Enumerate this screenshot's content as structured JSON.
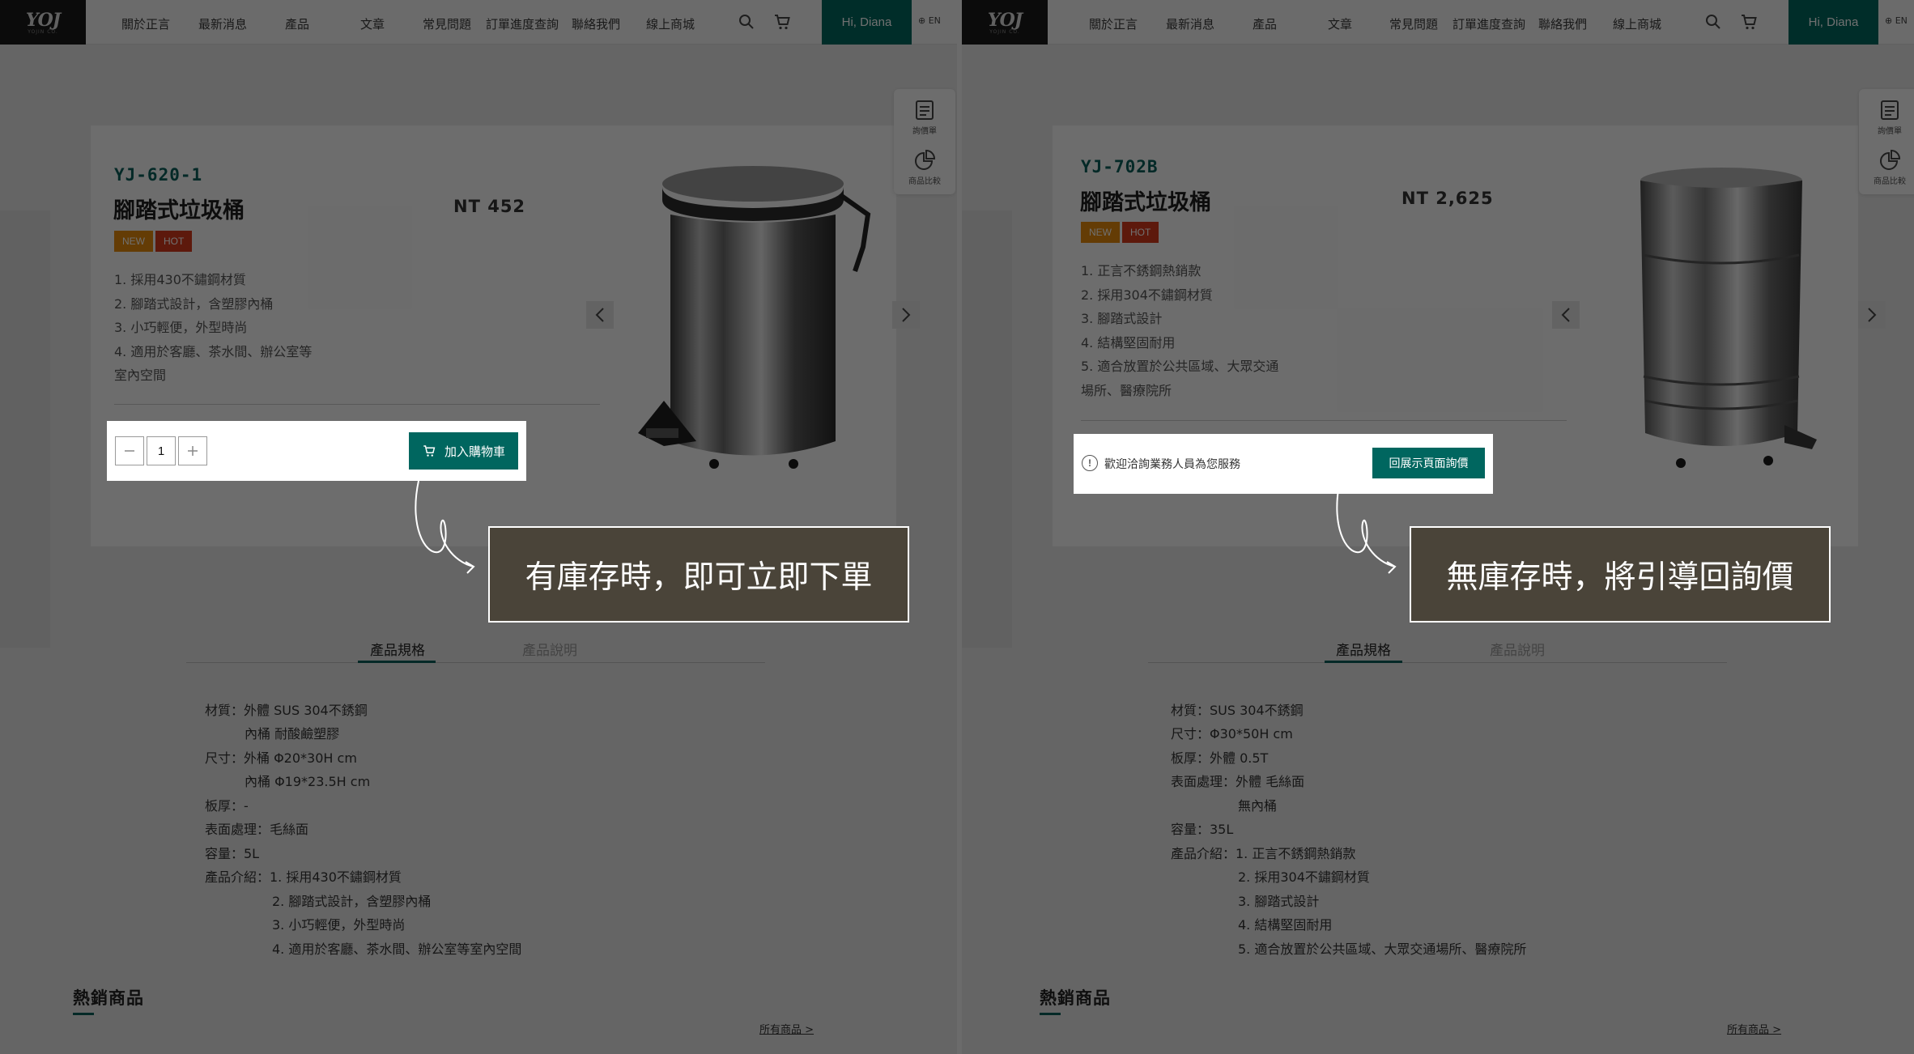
{
  "header": {
    "logo_text": "YOJ",
    "logo_subtext": "YOJIN CO.",
    "nav": [
      "關於正言",
      "最新消息",
      "產品",
      "文章",
      "常見問題",
      "訂單進度查詢",
      "聯絡我們",
      "線上商城"
    ],
    "user_greeting": "Hi, Diana",
    "lang": "EN",
    "icons": [
      "search-icon",
      "cart-icon",
      "globe-icon"
    ]
  },
  "side_tools": [
    {
      "label": "詢價單",
      "icon": "inquiry-list-icon"
    },
    {
      "label": "商品比較",
      "icon": "pie-chart-icon"
    }
  ],
  "left": {
    "model": "YJ-620-1",
    "name": "腳踏式垃圾桶",
    "price": "NT 452",
    "badges": [
      "NEW",
      "HOT"
    ],
    "features": [
      "1. 採用430不鏽鋼材質",
      "2. 腳踏式設計，含塑膠內桶",
      "3. 小巧輕便，外型時尚",
      "4. 適用於客廳、茶水間、辦公室等",
      "室內空間"
    ],
    "qty": "1",
    "cart_label": "加入購物車",
    "callout": "有庫存時，即可立即下單",
    "tabs": [
      "產品規格",
      "產品說明"
    ],
    "specs": [
      "材質：外體 SUS 304不銹鋼",
      "內桶 耐酸鹼塑膠",
      "尺寸：外桶 Φ20*30H cm",
      "內桶 Φ19*23.5H cm",
      "板厚：-",
      "表面處理：毛絲面",
      "容量：5L",
      "產品介紹：1. 採用430不鏽鋼材質",
      "2. 腳踏式設計，含塑膠內桶",
      "3. 小巧輕便，外型時尚",
      "4. 適用於客廳、茶水間、辦公室等室內空間"
    ],
    "hot_title": "熱銷商品",
    "all_link": "所有商品  >"
  },
  "right": {
    "model": "YJ-702B",
    "name": "腳踏式垃圾桶",
    "price": "NT 2,625",
    "badges": [
      "NEW",
      "HOT"
    ],
    "features": [
      "1. 正言不銹鋼熱銷款",
      "2. 採用304不鏽鋼材質",
      "3. 腳踏式設計",
      "4. 結構堅固耐用",
      "5. 適合放置於公共區域、大眾交通",
      "場所、醫療院所"
    ],
    "inquiry_text": "歡迎洽詢業務人員為您服務",
    "inquiry_button": "回展示頁面詢價",
    "callout": "無庫存時，將引導回詢價",
    "tabs": [
      "產品規格",
      "產品說明"
    ],
    "specs": [
      "材質：SUS 304不銹鋼",
      "尺寸：Φ30*50H cm",
      "板厚：外體 0.5T",
      "表面處理：外體 毛絲面",
      "無內桶",
      "容量：35L",
      "產品介紹：1. 正言不銹鋼熱銷款",
      "2. 採用304不鏽鋼材質",
      "3. 腳踏式設計",
      "4. 結構堅固耐用",
      "5. 適合放置於公共區域、大眾交通場所、醫療院所"
    ],
    "hot_title": "熱銷商品",
    "all_link": "所有商品  >"
  },
  "colors": {
    "brand": "#00665f",
    "new_badge": "#e48a0c",
    "hot_badge": "#d33a1d",
    "callout_bg": "#4a4439"
  }
}
